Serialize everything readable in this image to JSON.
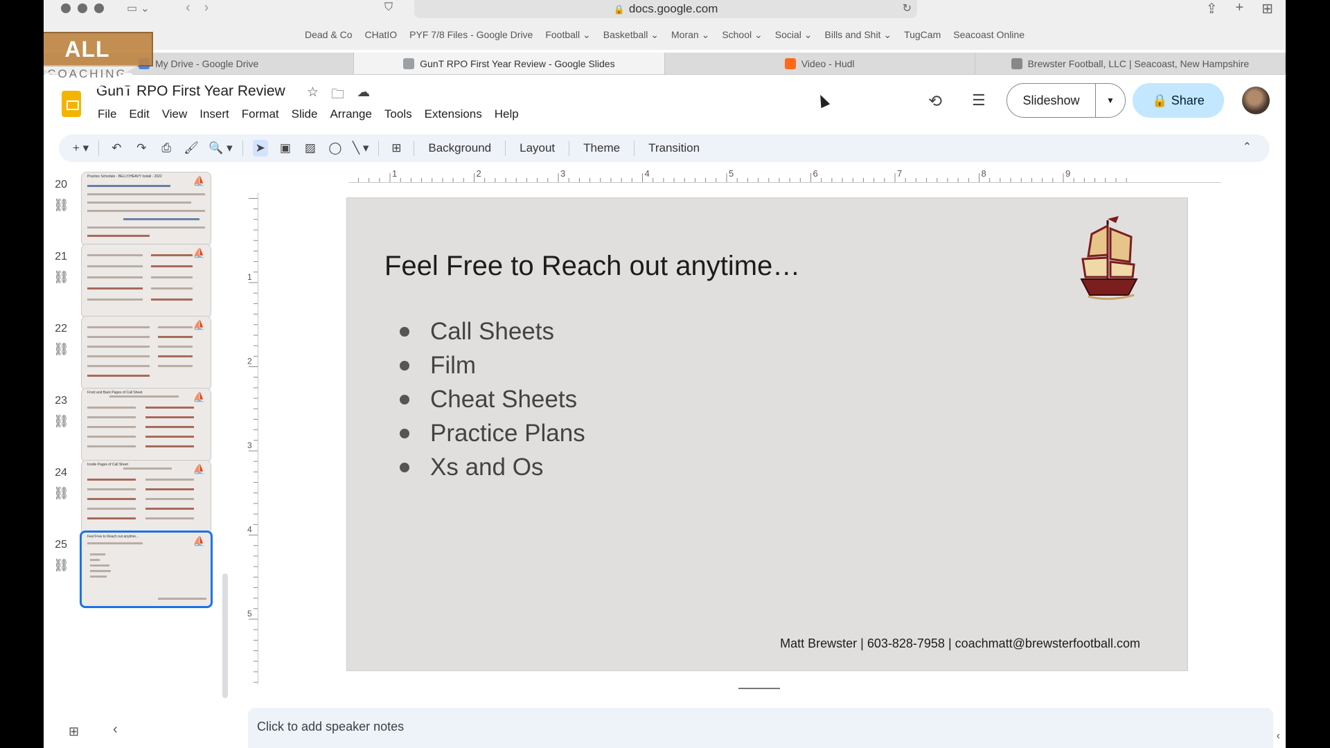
{
  "browser": {
    "url": "docs.google.com",
    "bookmarks": [
      "Dead & Co",
      "CHatIO",
      "PYF 7/8 Files - Google Drive",
      "Football ⌄",
      "Basketball ⌄",
      "Moran ⌄",
      "School ⌄",
      "Social ⌄",
      "Bills and Shit ⌄",
      "TugCam",
      "Seacoast Online"
    ],
    "tabs": [
      {
        "label": "My Drive - Google Drive",
        "color": "#4285f4"
      },
      {
        "label": "GunT RPO First Year Review - Google Slides",
        "color": "#9aa0a6"
      },
      {
        "label": "Video - Hudl",
        "color": "#ff6a1a"
      },
      {
        "label": "Brewster Football, LLC | Seacoast, New Hampshire",
        "color": "#888888"
      }
    ]
  },
  "watermark": {
    "top": "ALL ACCESS",
    "bottom": "COACHING"
  },
  "app": {
    "title": "GunT RPO First Year Review",
    "menu": [
      "File",
      "Edit",
      "View",
      "Insert",
      "Format",
      "Slide",
      "Arrange",
      "Tools",
      "Extensions",
      "Help"
    ],
    "slideshow_label": "Slideshow",
    "share_label": "Share"
  },
  "toolbar": {
    "background_label": "Background",
    "layout_label": "Layout",
    "theme_label": "Theme",
    "transition_label": "Transition"
  },
  "filmstrip": {
    "slides": [
      {
        "num": "20",
        "caption": "Practice Schedule - BELLY/HEAVY Install - 2022"
      },
      {
        "num": "21",
        "caption": ""
      },
      {
        "num": "22",
        "caption": ""
      },
      {
        "num": "23",
        "caption": "Front and Back Pages of Call Sheet"
      },
      {
        "num": "24",
        "caption": "Inside Pages of Call Sheet"
      },
      {
        "num": "25",
        "caption": "Feel Free to Reach out anytime..."
      }
    ]
  },
  "ruler": {
    "top": [
      "1",
      "2",
      "3",
      "4",
      "5",
      "6",
      "7",
      "8",
      "9"
    ],
    "left": [
      "1",
      "2",
      "3",
      "4",
      "5"
    ]
  },
  "slide": {
    "title": "Feel Free to Reach out anytime…",
    "bullets": [
      "Call Sheets",
      "Film",
      "Cheat Sheets",
      "Practice Plans",
      "Xs and Os"
    ],
    "contact": "Matt Brewster | 603-828-7958 | coachmatt@brewsterfootball.com"
  },
  "notes": {
    "placeholder": "Click to add speaker notes"
  }
}
